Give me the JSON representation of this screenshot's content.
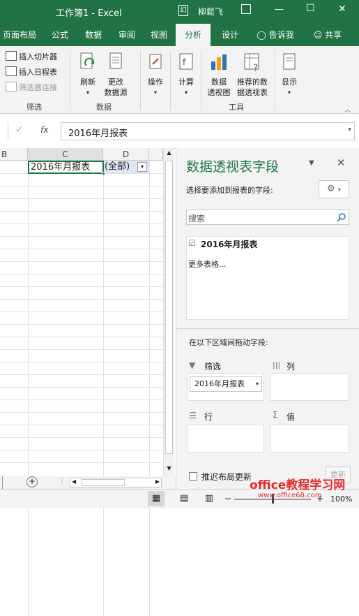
{
  "titlebar": {
    "title": "工作簿1  -  Excel",
    "user": "柳鬆飞",
    "min": "—",
    "max": "☐",
    "close": "✕"
  },
  "tabs": [
    {
      "label": "页面布局"
    },
    {
      "label": "公式"
    },
    {
      "label": "数据"
    },
    {
      "label": "审阅"
    },
    {
      "label": "视图"
    },
    {
      "label": "分析"
    },
    {
      "label": "设计"
    }
  ],
  "tellme": "告诉我",
  "share": "共享",
  "ribbon": {
    "filter": {
      "insert_slicer": "插入切片器",
      "insert_timeline": "插入日程表",
      "filter_connections": "筛选器连接",
      "label": "筛选"
    },
    "data": {
      "refresh": "刷新",
      "change_source_1": "更改",
      "change_source_2": "数据源",
      "label": "数据"
    },
    "actions": "操作",
    "calc": "计算",
    "tools": {
      "pivotchart_1": "数据",
      "pivotchart_2": "透视图",
      "recommended_1": "推荐的数",
      "recommended_2": "据透视表",
      "label": "工具"
    },
    "show": "显示"
  },
  "formula_bar": {
    "fx": "fx",
    "value": "2016年月报表"
  },
  "grid": {
    "col_b": "B",
    "col_c": "C",
    "col_d": "D",
    "cell_c1": "2016年月报表",
    "cell_d1": "(全部)"
  },
  "pane": {
    "title": "数据透视表字段",
    "choose_label": "选择要添加到报表的字段:",
    "search_placeholder": "搜索",
    "field_1": "2016年月报表",
    "more_tables": "更多表格...",
    "drag_label": "在以下区域间拖动字段:",
    "zone_filter": "筛选",
    "zone_columns": "列",
    "zone_rows": "行",
    "zone_values": "值",
    "filter_chip": "2016年月报表",
    "defer_update": "推迟布局更新",
    "update_button": "更新"
  },
  "status": {
    "zoom": "100%"
  },
  "watermark": {
    "line1": "office教程学习网",
    "line2": "www.office68.com"
  }
}
